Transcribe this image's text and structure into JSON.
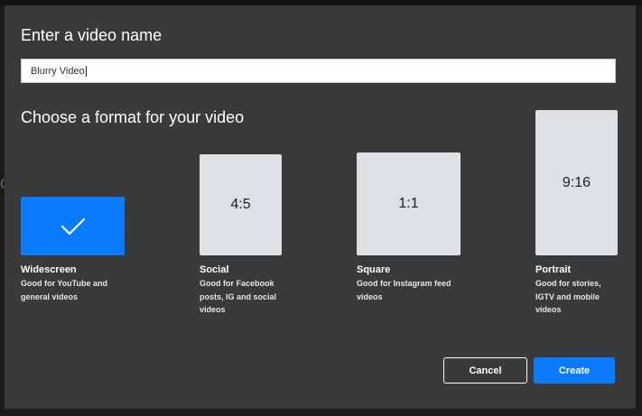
{
  "dialog": {
    "title": "Enter a video name",
    "name_value": "Blurry Video",
    "format_heading": "Choose a format for your video"
  },
  "formats": [
    {
      "label": "Widescreen",
      "ratio": "",
      "icon": "checkmark-icon",
      "selected": true,
      "desc": "Good for YouTube and general videos"
    },
    {
      "label": "Social",
      "ratio": "4:5",
      "selected": false,
      "desc": "Good for Facebook posts, IG and social videos"
    },
    {
      "label": "Square",
      "ratio": "1:1",
      "selected": false,
      "desc": "Good for Instagram feed videos"
    },
    {
      "label": "Portrait",
      "ratio": "9:16",
      "selected": false,
      "desc": "Good for stories, IGTV and mobile videos"
    }
  ],
  "actions": {
    "cancel_label": "Cancel",
    "create_label": "Create"
  },
  "colors": {
    "accent": "#0a7cff",
    "modal_bg": "#3a3a3a",
    "thumb_bg": "#dde0e5"
  }
}
